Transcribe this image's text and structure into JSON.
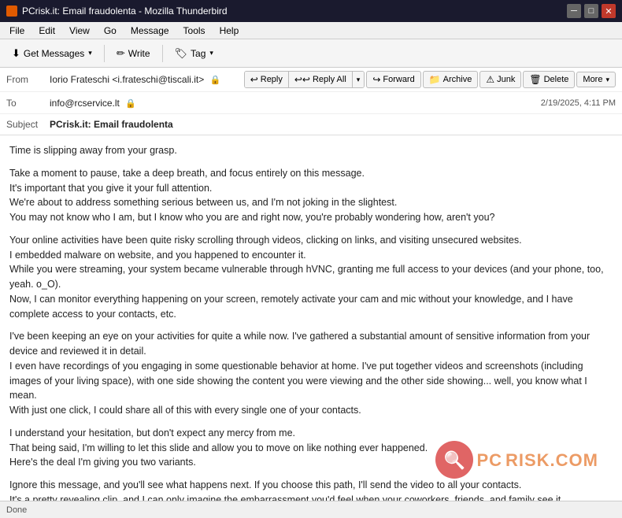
{
  "window": {
    "title": "PCrisk.it: Email fraudolenta - Mozilla Thunderbird",
    "icon": "thunderbird-icon"
  },
  "titlebar": {
    "controls": {
      "minimize": "─",
      "maximize": "□",
      "close": "✕"
    }
  },
  "menubar": {
    "items": [
      "File",
      "Edit",
      "View",
      "Go",
      "Message",
      "Tools",
      "Help"
    ]
  },
  "toolbar": {
    "get_messages_label": "Get Messages",
    "write_label": "Write",
    "tag_label": "Tag"
  },
  "email": {
    "from_label": "From",
    "from_value": "Iorio Frateschi <i.frateschi@tiscali.it>",
    "to_label": "To",
    "to_value": "info@rcservice.lt",
    "subject_label": "Subject",
    "subject_value": "PCrisk.it: Email fraudolenta",
    "timestamp": "2/19/2025, 4:11 PM",
    "actions": {
      "reply": "Reply",
      "reply_all": "Reply All",
      "forward": "Forward",
      "archive": "Archive",
      "junk": "Junk",
      "delete": "Delete",
      "more": "More"
    },
    "body_paragraphs": [
      "Time is slipping away from your grasp.",
      "Take a moment to pause, take a deep breath, and focus entirely on this message.\nIt's important that you give it your full attention.\nWe're about to address something serious between us, and I'm not joking in the slightest.\nYou may not know who I am, but I know who you are and right now, you're probably wondering how, aren't you?",
      "Your online activities have been quite risky scrolling through videos, clicking on links, and visiting unsecured websites.\nI embedded malware on website, and you happened to encounter it.\nWhile you were streaming, your system became vulnerable through hVNC, granting me full access to your devices (and your phone, too, yeah. o_O).\nNow, I can monitor everything happening on your screen, remotely activate your cam and mic without your knowledge, and I have complete access to your contacts, etc.",
      "I've been keeping an eye on your activities for quite a while now. I've gathered a substantial amount of sensitive information from your device and reviewed it in detail.\nI even have recordings of you engaging in some questionable behavior at home. I've put together videos and screenshots (including images of your living space), with one side showing the content you were viewing and the other side showing... well, you know what I mean.\nWith just one click, I could share all of this with every single one of your contacts.",
      "I understand your hesitation, but don't expect any mercy from me.\nThat being said, I'm willing to let this slide and allow you to move on like nothing ever happened.\nHere's the deal I'm giving you two variants.",
      "Ignore this message, and you'll see what happens next. If you choose this path, I'll send the video to all your contacts.\nIt's a pretty revealing clip, and I can only imagine the embarrassment you'd feel when your coworkers, friends, and family see it."
    ]
  },
  "statusbar": {
    "text": "Done"
  },
  "watermark": {
    "text": "RISK.COM"
  }
}
